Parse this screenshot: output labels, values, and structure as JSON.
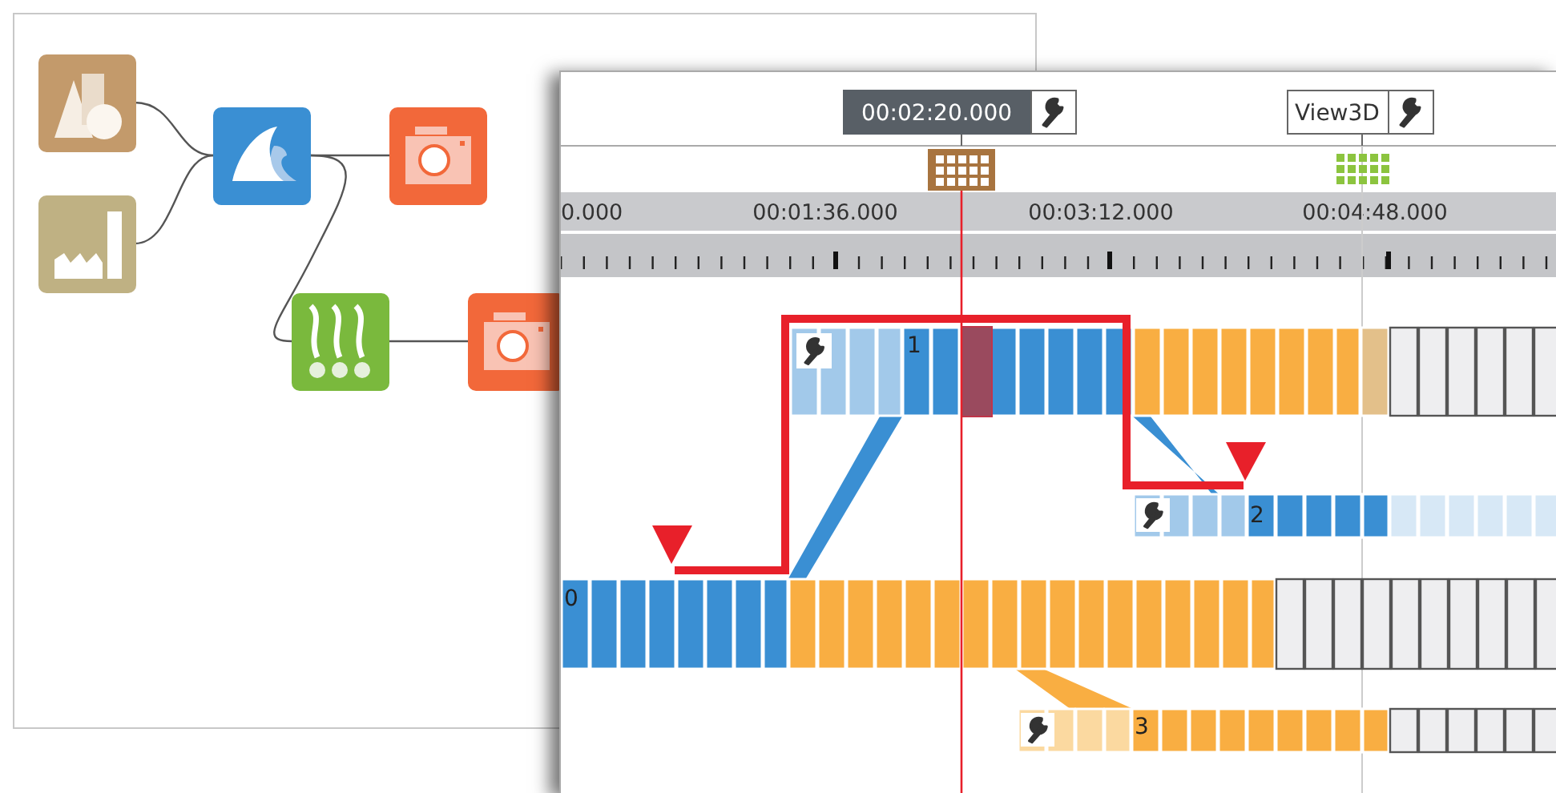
{
  "workflow": {
    "nodes": [
      {
        "kind": "shapes"
      },
      {
        "kind": "factory"
      },
      {
        "kind": "fin"
      },
      {
        "kind": "camera"
      },
      {
        "kind": "vapor"
      },
      {
        "kind": "camera"
      }
    ]
  },
  "timeline": {
    "markers": [
      {
        "label": "00:02:20.000",
        "selected": true
      },
      {
        "label": "View3D",
        "selected": false
      }
    ],
    "ruler_labels": [
      "0.000",
      "00:01:36.000",
      "00:03:12.000",
      "00:04:48.000"
    ],
    "tracks": [
      {
        "label": "0",
        "settings": false
      },
      {
        "label": "1",
        "settings": true
      },
      {
        "label": "2",
        "settings": true
      },
      {
        "label": "3",
        "settings": true
      }
    ]
  }
}
